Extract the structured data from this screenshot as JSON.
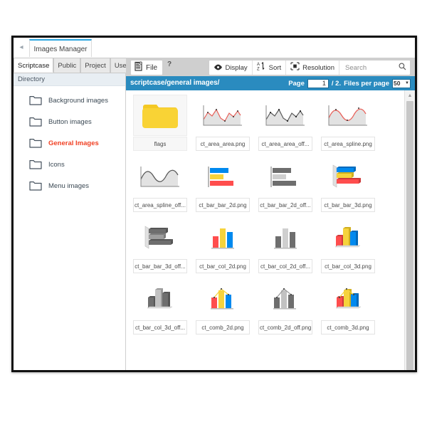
{
  "window": {
    "main_tab_label": "Images Manager",
    "collapse_icon": "chevron-left-icon"
  },
  "sidebar": {
    "tabs": [
      {
        "label": "Scriptcase",
        "active": true
      },
      {
        "label": "Public",
        "active": false
      },
      {
        "label": "Project",
        "active": false
      },
      {
        "label": "User",
        "active": false
      }
    ],
    "header": "Directory",
    "items": [
      {
        "label": "Background images",
        "selected": false
      },
      {
        "label": "Button images",
        "selected": false
      },
      {
        "label": "General Images",
        "selected": true
      },
      {
        "label": "Icons",
        "selected": false
      },
      {
        "label": "Menu images",
        "selected": false
      }
    ],
    "selected_color": "#f04124"
  },
  "toolbar": {
    "file_button": "File",
    "help_button": "?",
    "display_button": "Display",
    "sort_button": "Sort",
    "resolution_button": "Resolution",
    "search_placeholder": "Search",
    "search_value": ""
  },
  "pathbar": {
    "path": "scriptcase/general images/",
    "page_label": "Page",
    "page_value": "1",
    "page_total": "/ 2.",
    "files_per_page_label": "Files per page",
    "files_per_page_value": "50",
    "accent_color": "#2a8bbf"
  },
  "palette": {
    "blue": "#0089ef",
    "yellow": "#f6d33c",
    "red": "#ff4d4d",
    "gray_dark": "#6e6e6e",
    "gray_light": "#cccccc",
    "area_fill": "#e2e2e2",
    "line_red": "#e8615a",
    "folder_yellow": "#f9d335"
  },
  "files": [
    {
      "name": "flags",
      "type": "folder"
    },
    {
      "name": "ct_area_area.png",
      "type": "area-zigzag-color"
    },
    {
      "name": "ct_area_area_off...",
      "type": "area-zigzag-gray"
    },
    {
      "name": "ct_area_spline.png",
      "type": "area-spline-color"
    },
    {
      "name": "ct_area_spline_off...",
      "type": "area-spline-gray"
    },
    {
      "name": "ct_bar_bar_2d.png",
      "type": "bar-h-2d-color"
    },
    {
      "name": "ct_bar_bar_2d_off...",
      "type": "bar-h-2d-gray"
    },
    {
      "name": "ct_bar_bar_3d.png",
      "type": "bar-h-3d-color"
    },
    {
      "name": "ct_bar_bar_3d_off...",
      "type": "bar-h-3d-gray"
    },
    {
      "name": "ct_bar_col_2d.png",
      "type": "bar-v-2d-color"
    },
    {
      "name": "ct_bar_col_2d_off...",
      "type": "bar-v-2d-gray"
    },
    {
      "name": "ct_bar_col_3d.png",
      "type": "bar-v-3d-color"
    },
    {
      "name": "ct_bar_col_3d_off...",
      "type": "bar-v-3d-gray"
    },
    {
      "name": "ct_comb_2d.png",
      "type": "combo-2d-color"
    },
    {
      "name": "ct_comb_2d_off.png",
      "type": "combo-2d-gray"
    },
    {
      "name": "ct_comb_3d.png",
      "type": "combo-3d-color"
    }
  ],
  "scrollbar": {
    "up_arrow": "scroll-up-icon"
  }
}
